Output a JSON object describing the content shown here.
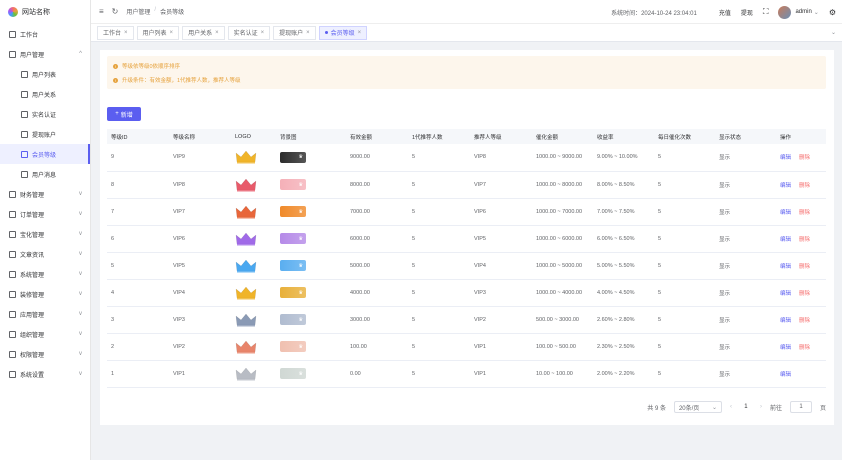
{
  "app": {
    "title": "网站名称"
  },
  "sidebar": {
    "items": [
      {
        "label": "工作台",
        "icon": "monitor-icon",
        "level": 0,
        "chevron": ""
      },
      {
        "label": "用户管理",
        "icon": "user-icon",
        "level": 0,
        "chevron": "^"
      },
      {
        "label": "用户列表",
        "icon": "user-icon",
        "level": 1,
        "chevron": ""
      },
      {
        "label": "用户关系",
        "icon": "users-icon",
        "level": 1,
        "chevron": ""
      },
      {
        "label": "实名认证",
        "icon": "id-card-icon",
        "level": 1,
        "chevron": ""
      },
      {
        "label": "提现账户",
        "icon": "card-icon",
        "level": 1,
        "chevron": ""
      },
      {
        "label": "会员等级",
        "icon": "pin-icon",
        "level": 1,
        "chevron": "",
        "active": true
      },
      {
        "label": "用户消息",
        "icon": "message-icon",
        "level": 1,
        "chevron": ""
      },
      {
        "label": "财务管理",
        "icon": "wallet-icon",
        "level": 0,
        "chevron": "v"
      },
      {
        "label": "订单管理",
        "icon": "order-icon",
        "level": 0,
        "chevron": "v"
      },
      {
        "label": "宝化管理",
        "icon": "box-icon",
        "level": 0,
        "chevron": "v"
      },
      {
        "label": "文章资讯",
        "icon": "article-icon",
        "level": 0,
        "chevron": "v"
      },
      {
        "label": "系统管理",
        "icon": "system-icon",
        "level": 0,
        "chevron": "v"
      },
      {
        "label": "装修管理",
        "icon": "decorate-icon",
        "level": 0,
        "chevron": "v"
      },
      {
        "label": "应用管理",
        "icon": "app-icon",
        "level": 0,
        "chevron": "v"
      },
      {
        "label": "组织管理",
        "icon": "org-icon",
        "level": 0,
        "chevron": "v"
      },
      {
        "label": "权限管理",
        "icon": "lock-icon",
        "level": 0,
        "chevron": "v"
      },
      {
        "label": "系统设置",
        "icon": "gear-icon",
        "level": 0,
        "chevron": "v"
      }
    ]
  },
  "header": {
    "breadcrumb": [
      "用户管理",
      "会员等级"
    ],
    "system_time": "系统时间：2024-10-24 23:04:01",
    "recharge": "充值",
    "withdraw": "提现",
    "user": "admin"
  },
  "tabs": [
    {
      "label": "工作台",
      "active": false
    },
    {
      "label": "用户列表",
      "active": false
    },
    {
      "label": "用户关系",
      "active": false
    },
    {
      "label": "实名认证",
      "active": false
    },
    {
      "label": "提现账户",
      "active": false
    },
    {
      "label": "会员等级",
      "active": true
    }
  ],
  "alerts": [
    "等级依等级0依顺序排序",
    "升级条件：有效金额，1代推荐人数，推荐人等级"
  ],
  "toolbar": {
    "add_label": "新增"
  },
  "table": {
    "columns": [
      "等级ID",
      "等级名称",
      "LOGO",
      "背景图",
      "有效金额",
      "1代推荐人数",
      "推荐人等级",
      "催化金额",
      "收益率",
      "每日催化次数",
      "显示状态",
      "操作"
    ],
    "rows": [
      {
        "id": "9",
        "name": "VIP9",
        "crown": "#f0b429",
        "bg": "#2b2b2b",
        "amount": "9000.00",
        "refs": "5",
        "ref_level": "VIP8",
        "range": "1000.00 ~ 9000.00",
        "rate": "9.00% ~ 10.00%",
        "times": "5",
        "status": "显示",
        "edit": "编辑",
        "del": "删除"
      },
      {
        "id": "8",
        "name": "VIP8",
        "crown": "#e85a6a",
        "bg": "#f5b0b8",
        "amount": "8000.00",
        "refs": "5",
        "ref_level": "VIP7",
        "range": "1000.00 ~ 8000.00",
        "rate": "8.00% ~ 8.50%",
        "times": "5",
        "status": "显示",
        "edit": "编辑",
        "del": "删除"
      },
      {
        "id": "7",
        "name": "VIP7",
        "crown": "#e8663a",
        "bg": "#f08a2a",
        "amount": "7000.00",
        "refs": "5",
        "ref_level": "VIP6",
        "range": "1000.00 ~ 7000.00",
        "rate": "7.00% ~ 7.50%",
        "times": "5",
        "status": "显示",
        "edit": "编辑",
        "del": "删除"
      },
      {
        "id": "6",
        "name": "VIP6",
        "crown": "#a06ae8",
        "bg": "#b58ae8",
        "amount": "6000.00",
        "refs": "5",
        "ref_level": "VIP5",
        "range": "1000.00 ~ 6000.00",
        "rate": "6.00% ~ 6.50%",
        "times": "5",
        "status": "显示",
        "edit": "编辑",
        "del": "删除"
      },
      {
        "id": "5",
        "name": "VIP5",
        "crown": "#4aa8f0",
        "bg": "#5aaef0",
        "amount": "5000.00",
        "refs": "5",
        "ref_level": "VIP4",
        "range": "1000.00 ~ 5000.00",
        "rate": "5.00% ~ 5.50%",
        "times": "5",
        "status": "显示",
        "edit": "编辑",
        "del": "删除"
      },
      {
        "id": "4",
        "name": "VIP4",
        "crown": "#f0b429",
        "bg": "#e8b03a",
        "amount": "4000.00",
        "refs": "5",
        "ref_level": "VIP3",
        "range": "1000.00 ~ 4000.00",
        "rate": "4.00% ~ 4.50%",
        "times": "5",
        "status": "显示",
        "edit": "编辑",
        "del": "删除"
      },
      {
        "id": "3",
        "name": "VIP3",
        "crown": "#8a9ab5",
        "bg": "#b0bcd0",
        "amount": "3000.00",
        "refs": "5",
        "ref_level": "VIP2",
        "range": "500.00 ~ 3000.00",
        "rate": "2.60% ~ 2.80%",
        "times": "5",
        "status": "显示",
        "edit": "编辑",
        "del": "删除"
      },
      {
        "id": "2",
        "name": "VIP2",
        "crown": "#e8846a",
        "bg": "#f0c0b0",
        "amount": "100.00",
        "refs": "5",
        "ref_level": "VIP1",
        "range": "100.00 ~ 500.00",
        "rate": "2.30% ~ 2.50%",
        "times": "5",
        "status": "显示",
        "edit": "编辑",
        "del": "删除"
      },
      {
        "id": "1",
        "name": "VIP1",
        "crown": "#b8bcc4",
        "bg": "#d0d8d4",
        "amount": "0.00",
        "refs": "5",
        "ref_level": "VIP1",
        "range": "10.00 ~ 100.00",
        "rate": "2.00% ~ 2.20%",
        "times": "5",
        "status": "显示",
        "edit": "编辑",
        "del": ""
      }
    ]
  },
  "pager": {
    "total": "共 9 条",
    "page_size": "20条/页",
    "current": "1",
    "goto_label": "前往",
    "goto_value": "1",
    "page_suffix": "页"
  }
}
